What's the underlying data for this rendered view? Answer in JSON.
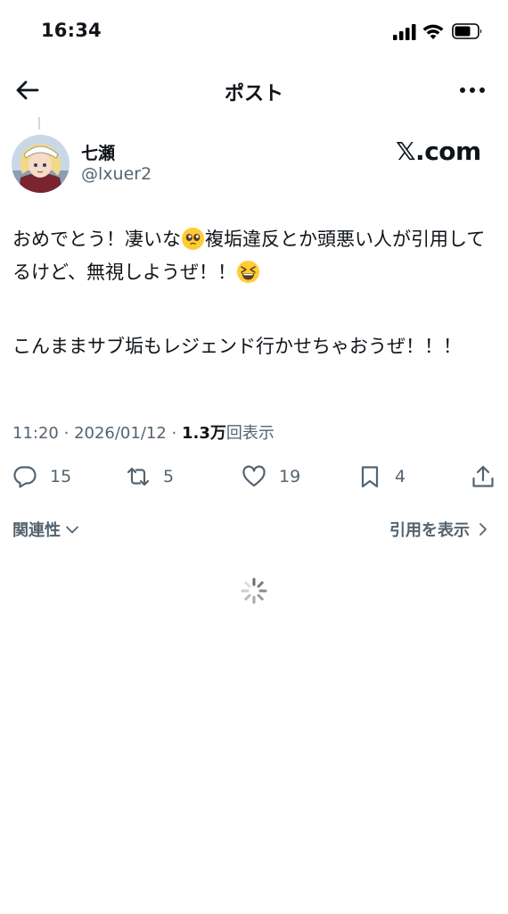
{
  "status_bar": {
    "time": "16:34"
  },
  "header": {
    "title": "ポスト"
  },
  "author": {
    "display_name": "七瀬",
    "handle": "@lxuer2",
    "source_logo": "𝕏.com"
  },
  "post": {
    "line1_a": "おめでとう！凄いな",
    "line1_b": "複垢違反とか頭悪い人が引用してるけど、無視しようぜ！！",
    "line2": "こんままサブ垢もレジェンド行かせちゃおうぜ！！！"
  },
  "meta": {
    "time": "11:20",
    "date": "2026/01/12",
    "views_count": "1.3万",
    "views_label": "回表示"
  },
  "actions": {
    "replies": "15",
    "retweets": "5",
    "likes": "19",
    "bookmarks": "4"
  },
  "sort": {
    "relevance_label": "関連性",
    "quotes_label": "引用を表示"
  },
  "icons": {
    "back": "arrow-left-icon",
    "more": "more-horizontal-icon",
    "reply": "speech-bubble-icon",
    "retweet": "retweet-icon",
    "like": "heart-icon",
    "bookmark": "bookmark-icon",
    "share": "share-icon",
    "emoji_1": "pleading-face-emoji",
    "emoji_2": "grinning-squinting-face-emoji"
  },
  "colors": {
    "text": "#0f1419",
    "secondary": "#536471",
    "divider": "#cfd9de"
  }
}
